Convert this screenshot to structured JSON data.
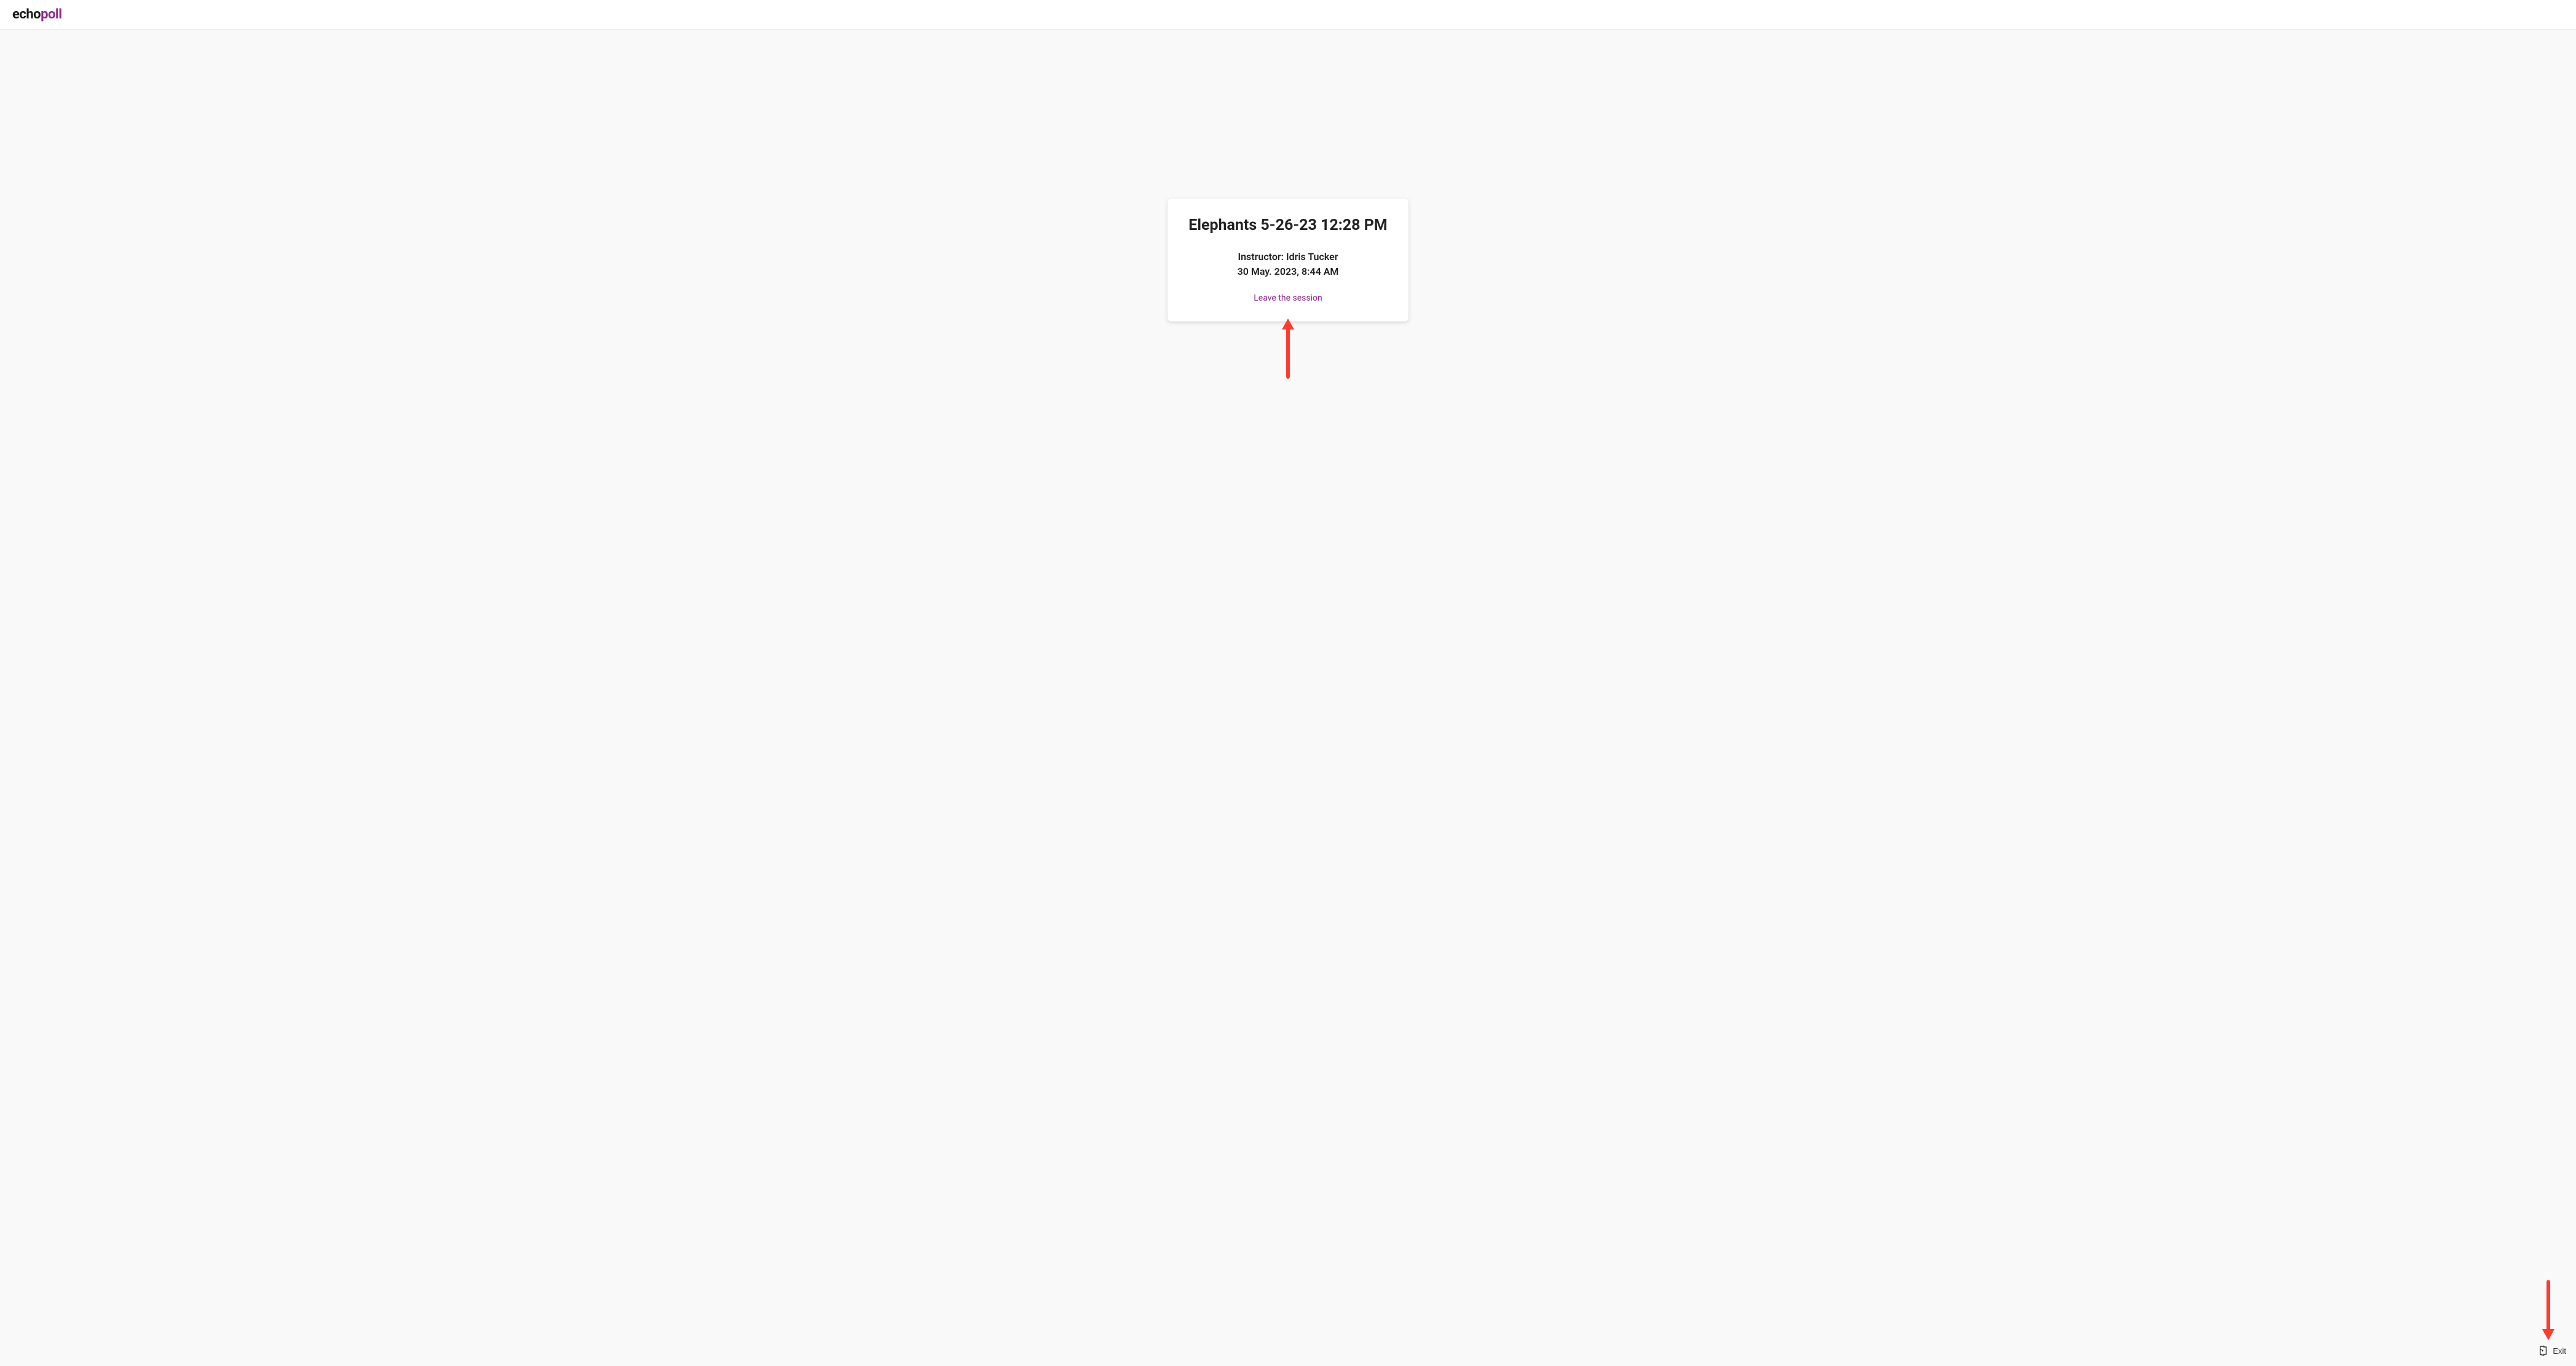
{
  "app": {
    "logo_part1": "echo",
    "logo_part2": "poll"
  },
  "session": {
    "title": "Elephants 5-26-23 12:28 PM",
    "instructor_line": "Instructor: Idris Tucker",
    "date_line": "30 May. 2023, 8:44 AM",
    "leave_label": "Leave the session"
  },
  "footer": {
    "exit_label": "Exit"
  },
  "colors": {
    "accent": "#8e2a8e",
    "annotation": "#ff3b30"
  }
}
